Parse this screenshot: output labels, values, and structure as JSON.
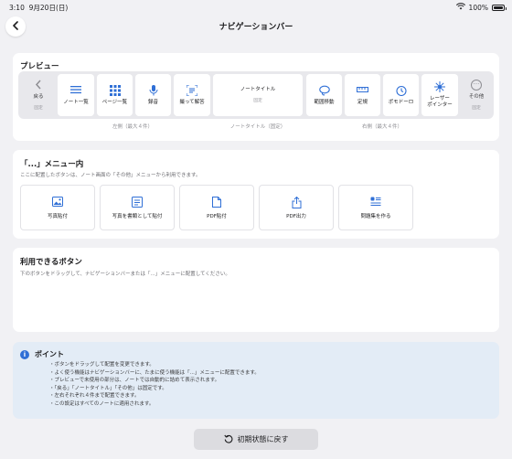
{
  "status_bar": {
    "time": "3:10",
    "date": "9月20日(日)",
    "battery": "100%"
  },
  "header": {
    "title": "ナビゲーションバー"
  },
  "preview": {
    "title": "プレビュー",
    "back": {
      "label": "戻る",
      "sub": "固定"
    },
    "left_items": [
      "ノート一覧",
      "ページ一覧",
      "録音",
      "撮って解答"
    ],
    "note_title": {
      "label": "ノートタイトル",
      "sub": "固定"
    },
    "right_items": [
      "範囲移動",
      "定規",
      "ポモドーロ",
      "レーザー\nポインター"
    ],
    "more": {
      "label": "その他",
      "sub": "固定"
    },
    "captions": {
      "left": "左側（最大４件）",
      "center": "ノートタイトル（固定）",
      "right": "右側（最大４件）"
    }
  },
  "menu": {
    "title": "「...」メニュー内",
    "description": "ここに配置したボタンは、ノート画面の「その他」メニューから利用できます。",
    "items": [
      "写真貼付",
      "写真を書類として貼付",
      "PDF貼付",
      "PDF出力",
      "問題集を作る"
    ]
  },
  "available": {
    "title": "利用できるボタン",
    "description": "下のボタンをドラッグして、ナビゲーションバーまたは「...」メニューに配置してください。"
  },
  "tips": {
    "title": "ポイント",
    "items": [
      "ボタンをドラッグして配置を変更できます。",
      "よく使う機能はナビゲーションバーに、たまに使う機能は「...」メニューに配置できます。",
      "プレビューで未使用の部分は、ノートでは自動的に詰めて表示されます。",
      "「戻る」「ノートタイトル」「その他」は固定です。",
      "左右それぞれ４件まで配置できます。",
      "この設定はすべてのノートに適用されます。"
    ]
  },
  "reset_button": "初期状態に戻す",
  "icons": {
    "back": "chevron-left-icon",
    "list": "list-icon",
    "grid": "grid-icon",
    "mic": "mic-icon",
    "scan": "scan-icon",
    "lasso": "lasso-icon",
    "ruler": "ruler-icon",
    "timer": "timer-icon",
    "laser": "laser-icon",
    "more": "more-icon",
    "photo": "photo-icon",
    "doc": "document-icon",
    "export": "share-icon",
    "problem": "problem-set-icon",
    "info": "info-icon",
    "reset": "reset-icon"
  },
  "colors": {
    "accent": "#2f6fd6",
    "tips_bg": "#e3ecf6",
    "page_bg": "#f1f1f4"
  }
}
